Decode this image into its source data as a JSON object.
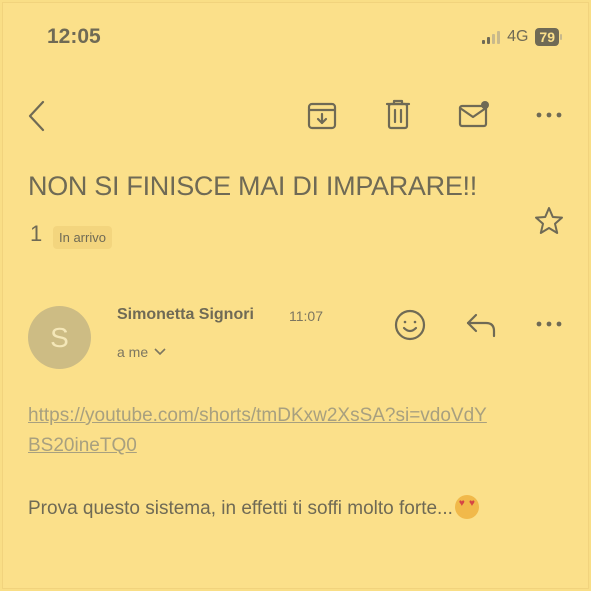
{
  "status_bar": {
    "time": "12:05",
    "network": "4G",
    "battery": "79"
  },
  "toolbar": {
    "back_icon": "chevron-left-icon",
    "archive_icon": "archive-icon",
    "delete_icon": "trash-icon",
    "unread_icon": "mail-unread-icon",
    "more_icon": "more-icon"
  },
  "message": {
    "subject": "NON SI FINISCE MAI DI IMPARARE!!",
    "count": "1",
    "label": "In arrivo",
    "star_icon": "star-icon",
    "sender_initial": "S",
    "sender_name": "Simonetta Signori",
    "time": "11:07",
    "recipient": "a me",
    "link": "https://youtube.com/shorts/tmDKxw2XsSA?si=vdoVdYBS20ineTQ0",
    "body": "Prova questo sistema, in effetti ti soffi molto forte..."
  },
  "colors": {
    "background": "#fbe08a",
    "text": "#6f6a55",
    "avatar": "#cdbc84"
  }
}
